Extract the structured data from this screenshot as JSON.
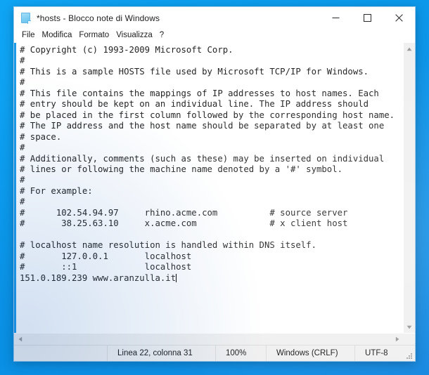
{
  "window": {
    "title": "*hosts - Blocco note di Windows",
    "icon": "notepad-document-icon",
    "controls": {
      "minimize": "minimize-icon",
      "maximize": "maximize-icon",
      "close": "close-icon"
    }
  },
  "menubar": {
    "items": [
      {
        "label": "File"
      },
      {
        "label": "Modifica"
      },
      {
        "label": "Formato"
      },
      {
        "label": "Visualizza"
      },
      {
        "label": "?"
      }
    ]
  },
  "editor": {
    "text": "# Copyright (c) 1993-2009 Microsoft Corp.\n#\n# This is a sample HOSTS file used by Microsoft TCP/IP for Windows.\n#\n# This file contains the mappings of IP addresses to host names. Each\n# entry should be kept on an individual line. The IP address should\n# be placed in the first column followed by the corresponding host name.\n# The IP address and the host name should be separated by at least one\n# space.\n#\n# Additionally, comments (such as these) may be inserted on individual\n# lines or following the machine name denoted by a '#' symbol.\n#\n# For example:\n#\n#      102.54.94.97     rhino.acme.com          # source server\n#       38.25.63.10     x.acme.com              # x client host\n\n# localhost name resolution is handled within DNS itself.\n#       127.0.0.1       localhost\n#       ::1             localhost\n151.0.189.239 www.aranzulla.it",
    "caret_visible": true
  },
  "scrollbars": {
    "vertical": {
      "up_arrow": "scroll-up-icon",
      "down_arrow": "scroll-down-icon"
    },
    "horizontal": {
      "left_arrow": "scroll-left-icon",
      "right_arrow": "scroll-right-icon"
    }
  },
  "statusbar": {
    "position": "Linea 22, colonna 31",
    "zoom": "100%",
    "line_endings": "Windows (CRLF)",
    "encoding": "UTF-8"
  },
  "colors": {
    "desktop": "#0c9eef",
    "accent_bar": "#1a9ae8",
    "window_bg": "#ffffff",
    "chrome": "#f0f0f0",
    "text": "#252525"
  }
}
